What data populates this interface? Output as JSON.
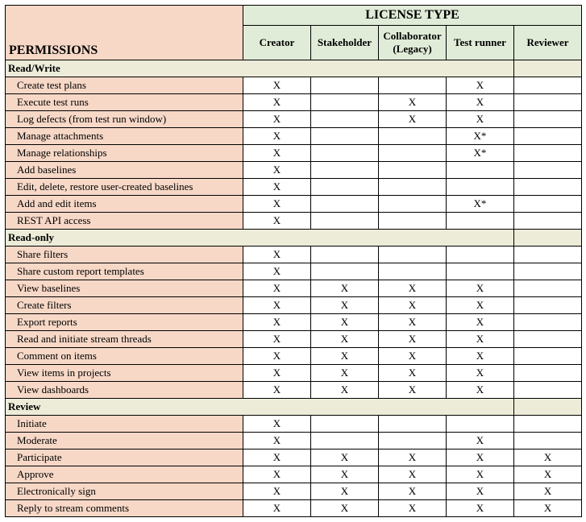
{
  "headers": {
    "permissions": "PERMISSIONS",
    "license_type": "LICENSE TYPE",
    "columns": [
      "Creator",
      "Stakeholder",
      "Collaborator (Legacy)",
      "Test runner",
      "Reviewer"
    ]
  },
  "sections": [
    {
      "title": "Read/Write",
      "rows": [
        {
          "label": "Create test plans",
          "marks": [
            "X",
            "",
            "",
            "X",
            ""
          ]
        },
        {
          "label": "Execute test runs",
          "marks": [
            "X",
            "",
            "X",
            "X",
            ""
          ]
        },
        {
          "label": "Log defects (from test run window)",
          "marks": [
            "X",
            "",
            "X",
            "X",
            ""
          ]
        },
        {
          "label": "Manage attachments",
          "marks": [
            "X",
            "",
            "",
            "X*",
            ""
          ]
        },
        {
          "label": "Manage relationships",
          "marks": [
            "X",
            "",
            "",
            "X*",
            ""
          ]
        },
        {
          "label": "Add baselines",
          "marks": [
            "X",
            "",
            "",
            "",
            ""
          ]
        },
        {
          "label": "Edit, delete, restore user-created baselines",
          "marks": [
            "X",
            "",
            "",
            "",
            ""
          ]
        },
        {
          "label": "Add and edit items",
          "marks": [
            "X",
            "",
            "",
            "X*",
            ""
          ]
        },
        {
          "label": "REST API access",
          "marks": [
            "X",
            "",
            "",
            "",
            ""
          ]
        }
      ]
    },
    {
      "title": "Read-only",
      "rows": [
        {
          "label": "Share filters",
          "marks": [
            "X",
            "",
            "",
            "",
            ""
          ]
        },
        {
          "label": "Share custom report templates",
          "marks": [
            "X",
            "",
            "",
            "",
            ""
          ]
        },
        {
          "label": "View baselines",
          "marks": [
            "X",
            "X",
            "X",
            "X",
            ""
          ]
        },
        {
          "label": "Create filters",
          "marks": [
            "X",
            "X",
            "X",
            "X",
            ""
          ]
        },
        {
          "label": "Export reports",
          "marks": [
            "X",
            "X",
            "X",
            "X",
            ""
          ]
        },
        {
          "label": "Read and initiate stream threads",
          "marks": [
            "X",
            "X",
            "X",
            "X",
            ""
          ]
        },
        {
          "label": "Comment on items",
          "marks": [
            "X",
            "X",
            "X",
            "X",
            ""
          ]
        },
        {
          "label": "View items in projects",
          "marks": [
            "X",
            "X",
            "X",
            "X",
            ""
          ]
        },
        {
          "label": "View dashboards",
          "marks": [
            "X",
            "X",
            "X",
            "X",
            ""
          ]
        }
      ]
    },
    {
      "title": "Review",
      "rows": [
        {
          "label": "Initiate",
          "marks": [
            "X",
            "",
            "",
            "",
            ""
          ]
        },
        {
          "label": "Moderate",
          "marks": [
            "X",
            "",
            "",
            "X",
            ""
          ]
        },
        {
          "label": "Participate",
          "marks": [
            "X",
            "X",
            "X",
            "X",
            "X"
          ]
        },
        {
          "label": "Approve",
          "marks": [
            "X",
            "X",
            "X",
            "X",
            "X"
          ]
        },
        {
          "label": "Electronically sign",
          "marks": [
            "X",
            "X",
            "X",
            "X",
            "X"
          ]
        },
        {
          "label": "Reply to stream comments",
          "marks": [
            "X",
            "X",
            "X",
            "X",
            "X"
          ]
        }
      ]
    }
  ]
}
